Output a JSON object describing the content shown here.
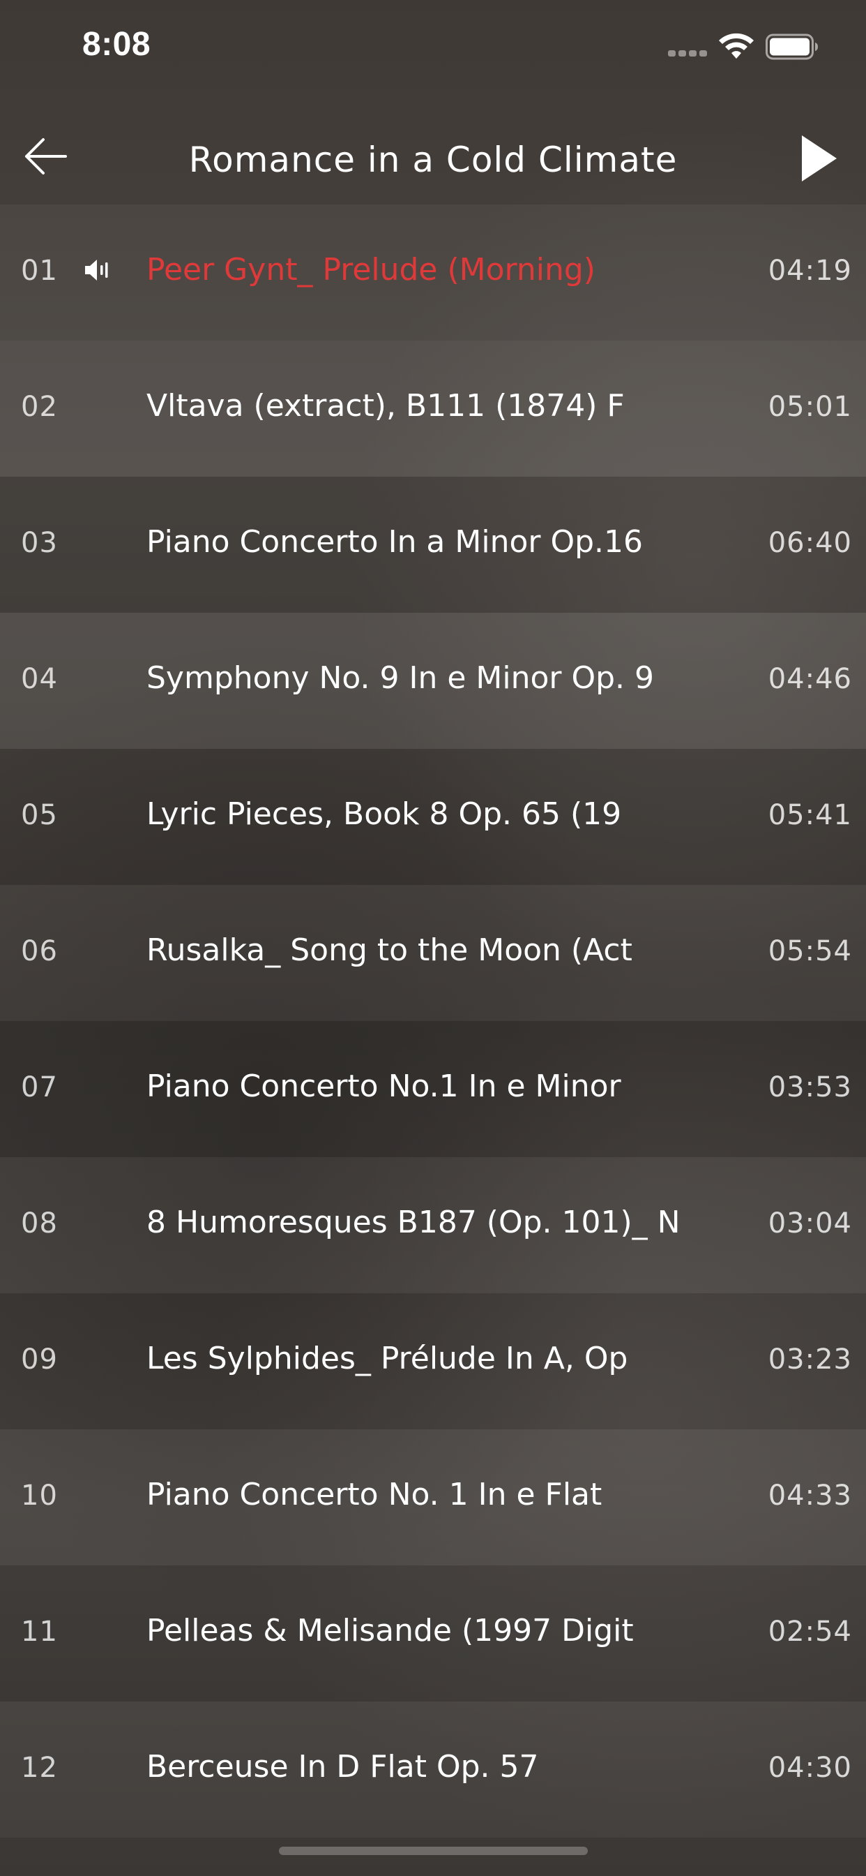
{
  "status_bar": {
    "time": "8:08",
    "icons": [
      "signal-icon",
      "wifi-icon",
      "battery-icon"
    ]
  },
  "nav": {
    "title": "Romance in a Cold Climate",
    "back_icon": "back-arrow-icon",
    "play_icon": "play-icon"
  },
  "colors": {
    "playing_accent": "#e0393a",
    "text": "#ffffff",
    "background": "#413c39"
  },
  "tracks": [
    {
      "number": "01",
      "title": "Peer Gynt_ Prelude (Morning)",
      "duration": "04:19",
      "playing": true
    },
    {
      "number": "02",
      "title": "Vltava (extract), B111 (1874) F",
      "duration": "05:01",
      "playing": false
    },
    {
      "number": "03",
      "title": "Piano Concerto In a Minor Op.16",
      "duration": "06:40",
      "playing": false
    },
    {
      "number": "04",
      "title": "Symphony No. 9 In e Minor Op. 9",
      "duration": "04:46",
      "playing": false
    },
    {
      "number": "05",
      "title": "Lyric Pieces, Book 8 Op. 65 (19",
      "duration": "05:41",
      "playing": false
    },
    {
      "number": "06",
      "title": "Rusalka_ Song to the Moon (Act",
      "duration": "05:54",
      "playing": false
    },
    {
      "number": "07",
      "title": "Piano Concerto No.1 In e Minor",
      "duration": "03:53",
      "playing": false
    },
    {
      "number": "08",
      "title": "8 Humoresques B187 (Op. 101)_ N",
      "duration": "03:04",
      "playing": false
    },
    {
      "number": "09",
      "title": "Les Sylphides_ Prélude In A, Op",
      "duration": "03:23",
      "playing": false
    },
    {
      "number": "10",
      "title": "Piano Concerto No. 1 In e Flat",
      "duration": "04:33",
      "playing": false
    },
    {
      "number": "11",
      "title": "Pelleas & Melisande (1997 Digit",
      "duration": "02:54",
      "playing": false
    },
    {
      "number": "12",
      "title": "Berceuse In D Flat Op. 57",
      "duration": "04:30",
      "playing": false
    }
  ]
}
